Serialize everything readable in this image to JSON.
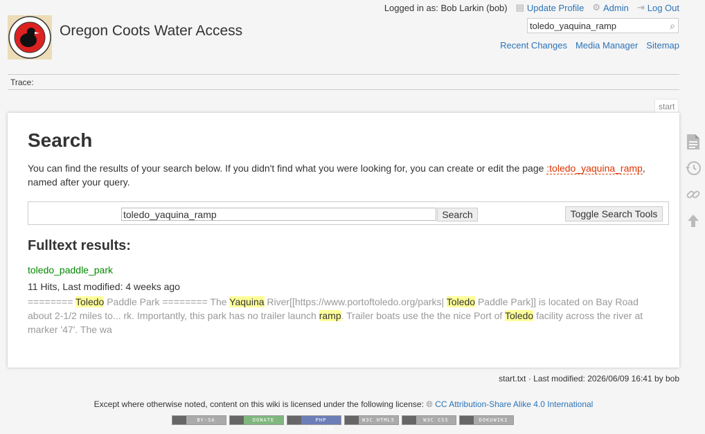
{
  "header": {
    "site_title": "Oregon Coots Water Access",
    "logged_in": "Logged in as: Bob Larkin (bob)",
    "update_profile": "Update Profile",
    "admin": "Admin",
    "logout": "Log Out",
    "search_value": "toledo_yaquina_ramp",
    "recent_changes": "Recent Changes",
    "media_manager": "Media Manager",
    "sitemap": "Sitemap",
    "trace": "Trace:"
  },
  "page_tab": "start",
  "main": {
    "title": "Search",
    "intro_before": "You can find the results of your search below. If you didn't find what you were looking for, you can create or edit the page ",
    "intro_link": ":toledo_yaquina_ramp",
    "intro_after": ", named after your query.",
    "query_value": "toledo_yaquina_ramp",
    "search_button": "Search",
    "toggle_button": "Toggle Search Tools",
    "fulltext_heading": "Fulltext results:",
    "result": {
      "link": "toledo_paddle_park",
      "meta": "11 Hits, Last modified: 4 weeks ago",
      "snippet_parts": [
        {
          "t": "======== ",
          "h": false
        },
        {
          "t": "Toledo",
          "h": true
        },
        {
          "t": " Paddle Park ======== The ",
          "h": false
        },
        {
          "t": "Yaquina",
          "h": true
        },
        {
          "t": " River[[https://www.portoftoledo.org/parks| ",
          "h": false
        },
        {
          "t": "Toledo",
          "h": true
        },
        {
          "t": " Paddle Park]] is located on Bay Road about 2-1/2 miles to... rk. Importantly, this park has no trailer launch ",
          "h": false
        },
        {
          "t": "ramp",
          "h": true
        },
        {
          "t": ". Trailer boats use the the nice Port of ",
          "h": false
        },
        {
          "t": "Toledo",
          "h": true
        },
        {
          "t": " facility across the river at marker '47'. The wa",
          "h": false
        }
      ]
    }
  },
  "footer": {
    "docinfo": "start.txt · Last modified: 2026/06/09 16:41 by bob",
    "license_text": "Except where otherwise noted, content on this wiki is licensed under the following license:",
    "license_link": "CC Attribution-Share Alike 4.0 International",
    "badges": [
      {
        "label": "BY-SA",
        "color": "#aaaaaa"
      },
      {
        "label": "DONATE",
        "color": "#7fb77e"
      },
      {
        "label": "PHP POWERED",
        "color": "#6c7eb7"
      },
      {
        "label": "W3C HTML5",
        "color": "#aaaaaa"
      },
      {
        "label": "W3C CSS",
        "color": "#aaaaaa"
      },
      {
        "label": "DOKUWIKI",
        "color": "#aaaaaa"
      }
    ]
  }
}
